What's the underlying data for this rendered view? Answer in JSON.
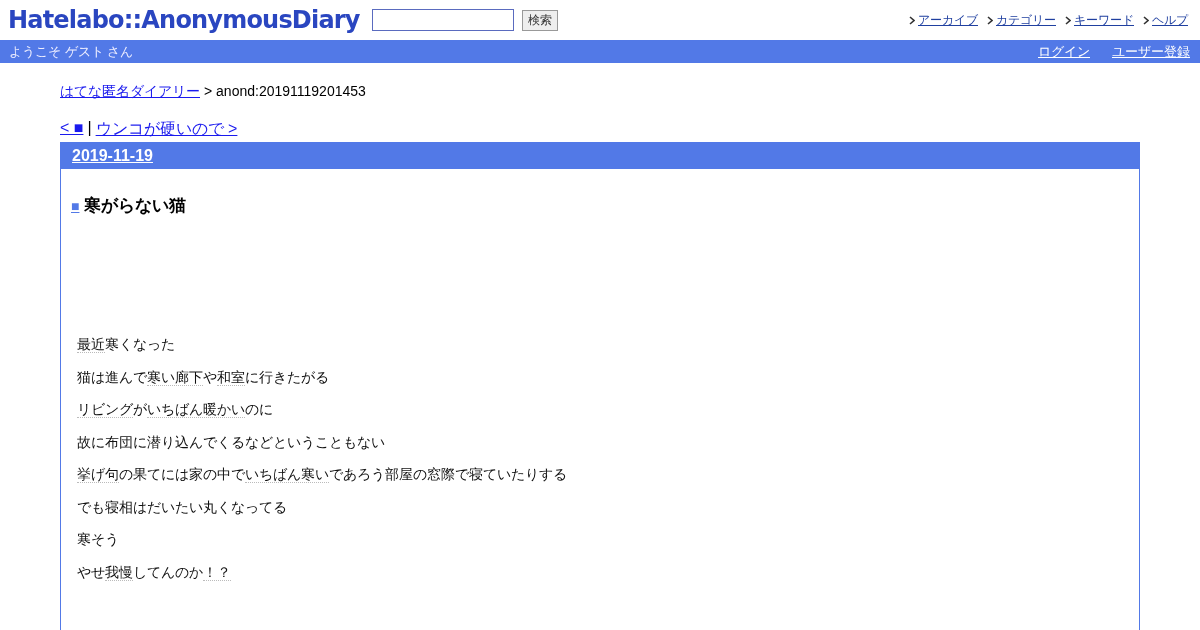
{
  "header": {
    "logo": "Hatelabo::AnonymousDiary",
    "search": {
      "button": "検索"
    },
    "nav": [
      "アーカイブ",
      "カテゴリー",
      "キーワード",
      "ヘルプ"
    ]
  },
  "welcome_bar": {
    "greeting": "ようこそ ゲスト さん",
    "links": [
      "ログイン",
      "ユーザー登録"
    ]
  },
  "breadcrumb": {
    "link": "はてな匿名ダイアリー",
    "current": "> anond:20191119201453"
  },
  "pager": {
    "prev": "< ■",
    "separator": "|",
    "next": "ウンコが硬いので >"
  },
  "day": {
    "date": "2019-11-19",
    "entry": {
      "mark": "■",
      "title": "寒がらない猫",
      "paragraphs": [
        [
          {
            "text": "最近",
            "keyword": true
          },
          {
            "text": "寒くなった",
            "keyword": false
          }
        ],
        [
          {
            "text": "猫は進んで",
            "keyword": false
          },
          {
            "text": "寒い廊下",
            "keyword": true
          },
          {
            "text": "や",
            "keyword": false
          },
          {
            "text": "和室",
            "keyword": true
          },
          {
            "text": "に行きたがる",
            "keyword": false
          }
        ],
        [
          {
            "text": "リビング",
            "keyword": true
          },
          {
            "text": "が",
            "keyword": false
          },
          {
            "text": "いちばん暖かい",
            "keyword": true
          },
          {
            "text": "のに",
            "keyword": false
          }
        ],
        [
          {
            "text": "故に布団に潜り込んでくるなどということもない",
            "keyword": false
          }
        ],
        [
          {
            "text": "挙げ句",
            "keyword": true
          },
          {
            "text": "の果てには家の中で",
            "keyword": false
          },
          {
            "text": "いちばん寒い",
            "keyword": true
          },
          {
            "text": "であろう部屋の窓際で寝ていたりする",
            "keyword": false
          }
        ],
        [
          {
            "text": "でも寝相はだいたい丸くなってる",
            "keyword": false
          }
        ],
        [
          {
            "text": "寒そう",
            "keyword": false
          }
        ],
        [
          {
            "text": "やせ",
            "keyword": false
          },
          {
            "text": "我慢",
            "keyword": true
          },
          {
            "text": "してんのか",
            "keyword": false
          },
          {
            "text": "！？",
            "keyword": true
          }
        ]
      ]
    }
  }
}
